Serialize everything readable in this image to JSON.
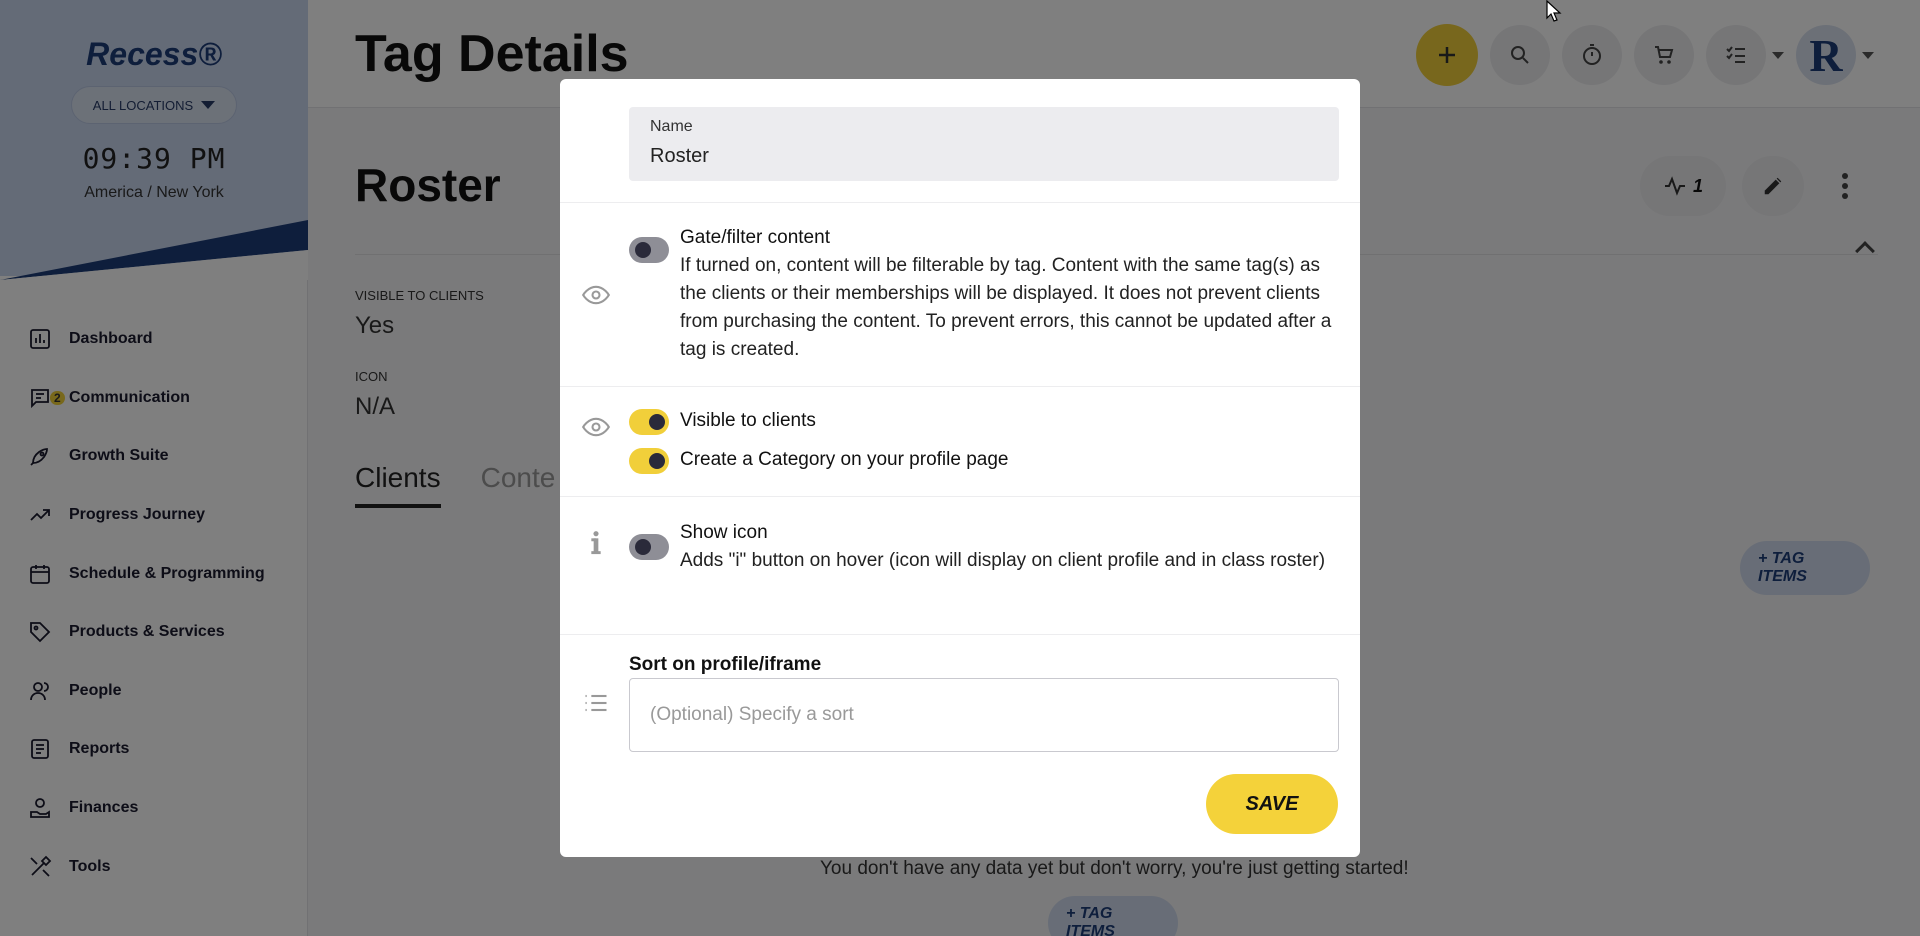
{
  "sidebar": {
    "brand": "Recess®",
    "location_button": "ALL LOCATIONS",
    "time": "09:39 PM",
    "timezone": "America / New York",
    "items": [
      {
        "label": "Dashboard",
        "icon": "bar-chart-icon"
      },
      {
        "label": "Communication",
        "icon": "chat-icon",
        "badge": "2"
      },
      {
        "label": "Growth Suite",
        "icon": "rocket-icon"
      },
      {
        "label": "Progress Journey",
        "icon": "trending-up-icon"
      },
      {
        "label": "Schedule & Programming",
        "icon": "calendar-icon"
      },
      {
        "label": "Products & Services",
        "icon": "tag-icon"
      },
      {
        "label": "People",
        "icon": "people-icon"
      },
      {
        "label": "Reports",
        "icon": "report-icon"
      },
      {
        "label": "Finances",
        "icon": "wallet-icon"
      },
      {
        "label": "Tools",
        "icon": "tools-icon"
      }
    ]
  },
  "header": {
    "title": "Tag Details",
    "avatar_letter": "R"
  },
  "main": {
    "roster_title": "Roster",
    "activity_count": "1",
    "fields": {
      "visible_label": "VISIBLE TO CLIENTS",
      "visible_value": "Yes",
      "icon_label": "ICON",
      "icon_value": "N/A"
    },
    "tabs": [
      "Clients",
      "Conte"
    ],
    "tag_items_label": "+ TAG ITEMS",
    "empty_message": "You don't have any data yet but don't worry, you're just getting started!"
  },
  "modal": {
    "name_label": "Name",
    "name_value": "Roster",
    "gate": {
      "title": "Gate/filter content",
      "description": "If turned on, content will be filterable by tag. Content with the same tag(s) as the clients or their memberships will be displayed. It does not prevent clients from purchasing the content. To prevent errors, this cannot be updated after a tag is created.",
      "enabled": false
    },
    "visible_to_clients": {
      "label": "Visible to clients",
      "enabled": true
    },
    "create_category": {
      "label": "Create a Category on your profile page",
      "enabled": true
    },
    "show_icon": {
      "title": "Show icon",
      "description": "Adds \"i\" button on hover (icon will display on client profile and in class roster)",
      "enabled": false
    },
    "sort_label": "Sort on profile/iframe",
    "sort_placeholder": "(Optional) Specify a sort",
    "save_label": "SAVE"
  },
  "colors": {
    "accent_yellow": "#f1cf3a",
    "brand_blue": "#1d3d79",
    "overlay": "rgba(0,0,0,0.5)"
  }
}
